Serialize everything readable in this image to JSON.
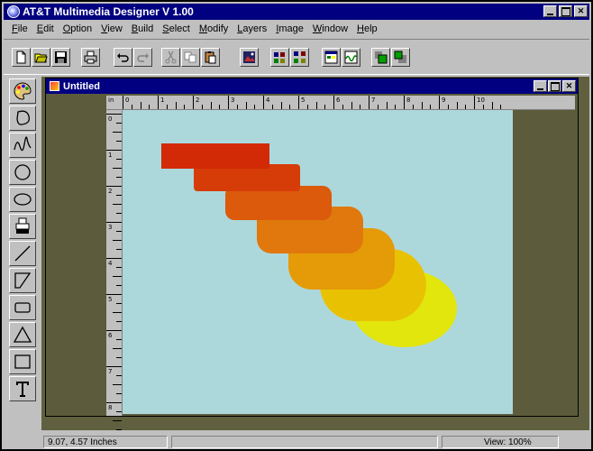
{
  "app": {
    "title": "AT&T Multimedia Designer V 1.00"
  },
  "menu": [
    {
      "label": "File",
      "hotkey": "F",
      "rest": "ile"
    },
    {
      "label": "Edit",
      "hotkey": "E",
      "rest": "dit"
    },
    {
      "label": "Option",
      "hotkey": "O",
      "rest": "ption"
    },
    {
      "label": "View",
      "hotkey": "V",
      "rest": "iew"
    },
    {
      "label": "Build",
      "hotkey": "B",
      "rest": "uild"
    },
    {
      "label": "Select",
      "hotkey": "S",
      "rest": "elect"
    },
    {
      "label": "Modify",
      "hotkey": "M",
      "rest": "odify"
    },
    {
      "label": "Layers",
      "hotkey": "L",
      "rest": "ayers"
    },
    {
      "label": "Image",
      "hotkey": "I",
      "rest": "mage"
    },
    {
      "label": "Window",
      "hotkey": "W",
      "rest": "indow"
    },
    {
      "label": "Help",
      "hotkey": "H",
      "rest": "elp"
    }
  ],
  "toolbar": [
    {
      "name": "new-file"
    },
    {
      "name": "open-file"
    },
    {
      "name": "save-file"
    },
    {
      "name": "print"
    },
    {
      "name": "undo"
    },
    {
      "name": "redo"
    },
    {
      "name": "cut"
    },
    {
      "name": "copy"
    },
    {
      "name": "paste"
    },
    {
      "name": "image-tool"
    },
    {
      "name": "group"
    },
    {
      "name": "ungroup"
    },
    {
      "name": "palette-view"
    },
    {
      "name": "wave-view"
    },
    {
      "name": "layer-front"
    },
    {
      "name": "layer-back"
    }
  ],
  "tools": [
    "color-palette",
    "lasso",
    "freehand",
    "circle",
    "ellipse",
    "stamp",
    "line",
    "polygon",
    "rounded-rectangle",
    "triangle",
    "rectangle",
    "text"
  ],
  "document": {
    "title": "Untitled"
  },
  "ruler": {
    "unit": "in",
    "h_labels": [
      "0",
      "1",
      "2",
      "3",
      "4",
      "5",
      "6",
      "7",
      "8",
      "9",
      "10"
    ],
    "v_labels": [
      "0",
      "1",
      "2",
      "3",
      "4",
      "5",
      "6",
      "7",
      "8"
    ]
  },
  "shapes": {
    "colors": [
      "#d22a06",
      "#d63c08",
      "#db5a0b",
      "#e0780e",
      "#e59a07",
      "#e8c202",
      "#e2e60c"
    ]
  },
  "status": {
    "cursor_position": "9.07, 4.57 Inches",
    "view": "View: 100%"
  }
}
